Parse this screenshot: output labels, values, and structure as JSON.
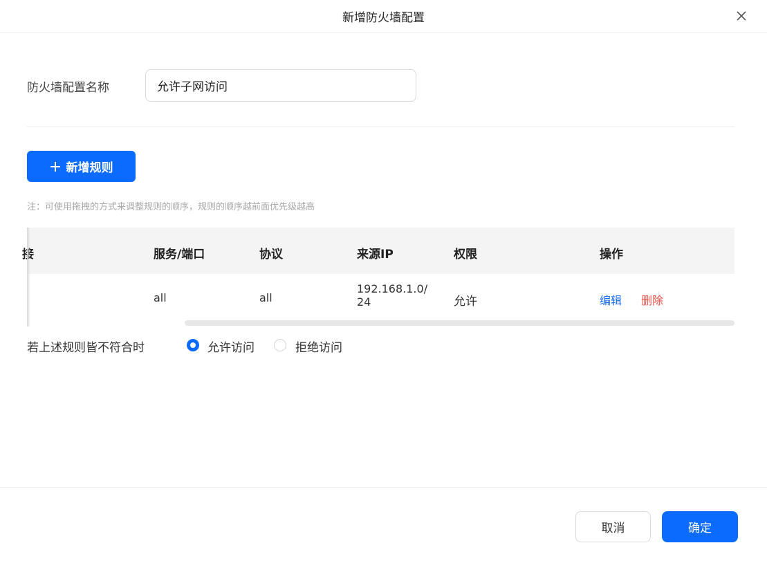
{
  "dialog": {
    "title": "新增防火墙配置",
    "close_icon": "close-icon"
  },
  "form": {
    "name_label": "防火墙配置名称",
    "name_value": "允许子网访问"
  },
  "add_rule": {
    "label": "新增规则",
    "icon": "plus-icon"
  },
  "note": "注：可使用拖拽的方式来调整规则的顺序，规则的顺序越前面优先级越高",
  "table": {
    "columns": {
      "partial": "接",
      "service_port": "服务/端口",
      "protocol": "协议",
      "source_ip": "来源IP",
      "permission": "权限",
      "actions": "操作"
    },
    "rows": [
      {
        "service_port": "all",
        "protocol": "all",
        "source_ip_line1": "192.168.1.0/",
        "source_ip_line2": "24",
        "permission": "允许",
        "edit": "编辑",
        "delete": "删除"
      }
    ]
  },
  "fallback": {
    "label": "若上述规则皆不符合时",
    "options": [
      {
        "label": "允许访问",
        "checked": true
      },
      {
        "label": "拒绝访问",
        "checked": false
      }
    ]
  },
  "footer": {
    "cancel": "取消",
    "confirm": "确定"
  },
  "colors": {
    "primary": "#0b6bff",
    "link": "#1a6cf5",
    "danger": "#e8524a"
  }
}
